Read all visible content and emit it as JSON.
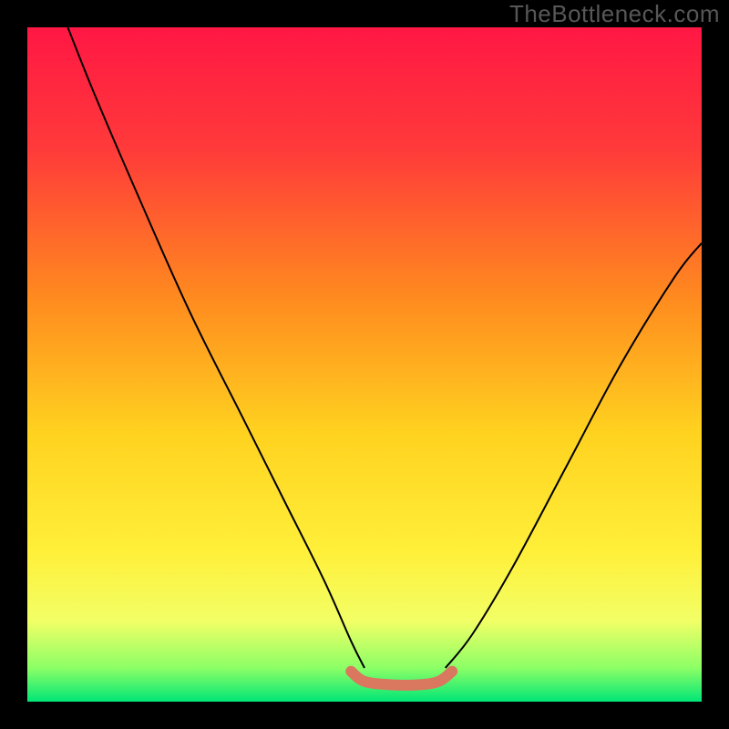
{
  "watermark": "TheBottleneck.com",
  "chart_data": {
    "type": "line",
    "title": "",
    "xlabel": "",
    "ylabel": "",
    "xlim": [
      0,
      100
    ],
    "ylim": [
      0,
      100
    ],
    "background_gradient_stops": [
      {
        "offset": 0,
        "color": "#ff1744"
      },
      {
        "offset": 18,
        "color": "#ff3a3a"
      },
      {
        "offset": 40,
        "color": "#ff8a1f"
      },
      {
        "offset": 60,
        "color": "#ffd21f"
      },
      {
        "offset": 78,
        "color": "#fff03a"
      },
      {
        "offset": 88,
        "color": "#f2ff66"
      },
      {
        "offset": 95,
        "color": "#8cff66"
      },
      {
        "offset": 100,
        "color": "#00e676"
      }
    ],
    "series": [
      {
        "name": "left-curve",
        "color": "#000000",
        "stroke_width": 2,
        "points": [
          {
            "x": 6,
            "y": 100
          },
          {
            "x": 10,
            "y": 90
          },
          {
            "x": 16,
            "y": 76
          },
          {
            "x": 24,
            "y": 58
          },
          {
            "x": 32,
            "y": 42
          },
          {
            "x": 38,
            "y": 30
          },
          {
            "x": 44,
            "y": 18
          },
          {
            "x": 48,
            "y": 9
          },
          {
            "x": 50,
            "y": 5
          }
        ]
      },
      {
        "name": "right-curve",
        "color": "#000000",
        "stroke_width": 2,
        "points": [
          {
            "x": 62,
            "y": 5
          },
          {
            "x": 66,
            "y": 10
          },
          {
            "x": 72,
            "y": 20
          },
          {
            "x": 80,
            "y": 35
          },
          {
            "x": 88,
            "y": 50
          },
          {
            "x": 96,
            "y": 63
          },
          {
            "x": 100,
            "y": 68
          }
        ]
      },
      {
        "name": "bottom-zone",
        "color": "#d9785f",
        "stroke_width": 12,
        "stroke_linecap": "round",
        "points": [
          {
            "x": 48,
            "y": 4.5
          },
          {
            "x": 50,
            "y": 3
          },
          {
            "x": 54,
            "y": 2.5
          },
          {
            "x": 58,
            "y": 2.5
          },
          {
            "x": 61,
            "y": 3
          },
          {
            "x": 63,
            "y": 4.5
          }
        ]
      }
    ]
  }
}
